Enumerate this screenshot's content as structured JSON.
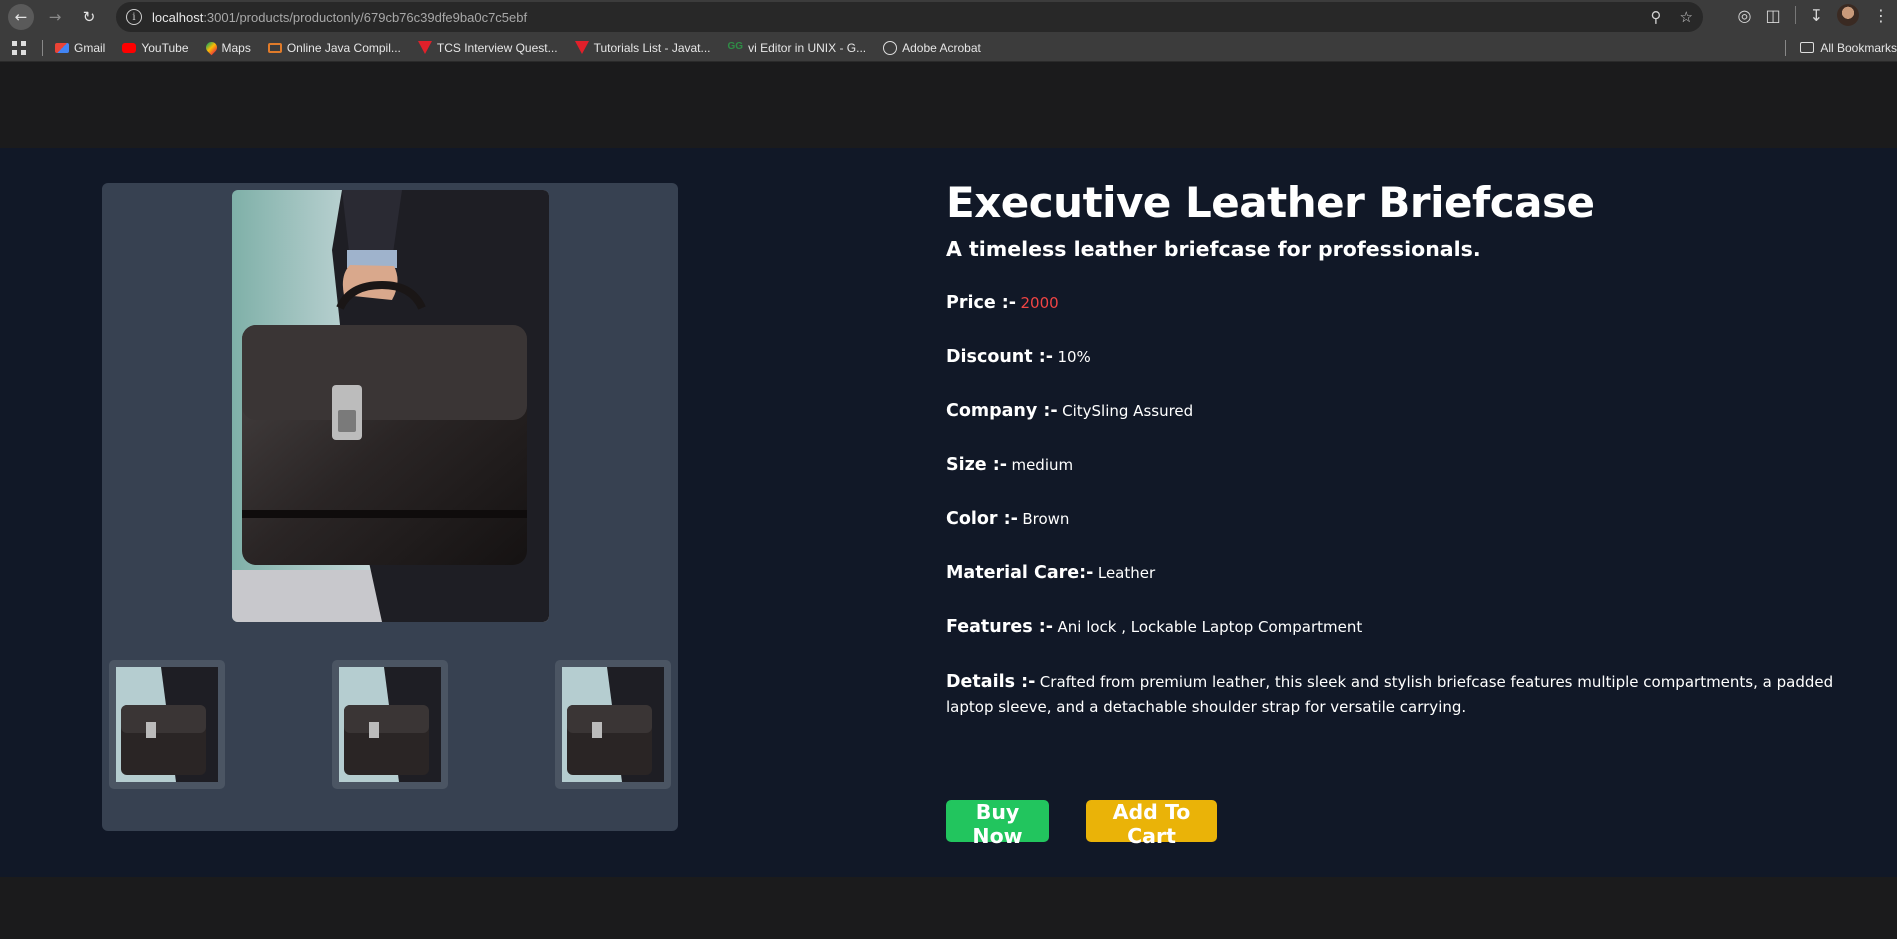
{
  "browser": {
    "url_host": "localhost",
    "url_path": ":3001/products/productonly/679cb76c39dfe9ba0c7c5ebf",
    "bookmarks": [
      {
        "label": "Gmail",
        "icon": "gmail-icon"
      },
      {
        "label": "YouTube",
        "icon": "youtube-icon"
      },
      {
        "label": "Maps",
        "icon": "maps-icon"
      },
      {
        "label": "Online Java Compil...",
        "icon": "java-icon"
      },
      {
        "label": "TCS Interview Quest...",
        "icon": "tcs-icon"
      },
      {
        "label": "Tutorials List - Javat...",
        "icon": "tcs-icon"
      },
      {
        "label": "vi Editor in UNIX - G...",
        "icon": "gfg-icon"
      },
      {
        "label": "Adobe Acrobat",
        "icon": "globe-icon"
      }
    ],
    "all_bookmarks": "All Bookmarks"
  },
  "product": {
    "title": "Executive Leather Briefcase",
    "subtitle": "A timeless leather briefcase for professionals.",
    "fields": {
      "price": {
        "label": "Price :-",
        "value": "2000"
      },
      "discount": {
        "label": "Discount :-",
        "value": "10%"
      },
      "company": {
        "label": "Company :-",
        "value": "CitySling Assured"
      },
      "size": {
        "label": "Size :-",
        "value": "medium"
      },
      "color": {
        "label": "Color :-",
        "value": "Brown"
      },
      "material": {
        "label": "Material Care:-",
        "value": "Leather"
      },
      "features": {
        "label": "Features :-",
        "value": "Ani lock , Lockable Laptop Compartment"
      },
      "details": {
        "label": "Details :-",
        "value": "Crafted from premium leather, this sleek and stylish briefcase features multiple compartments, a padded laptop sleeve, and a detachable shoulder strap for versatile carrying."
      }
    },
    "buy_label": "Buy Now",
    "cart_label": "Add To Cart"
  },
  "colors": {
    "page_bg": "#1b1b1c",
    "product_bg": "#111827",
    "gallery_bg": "#374151",
    "price": "#ef4444",
    "buy": "#22c55e",
    "cart": "#eab308"
  }
}
